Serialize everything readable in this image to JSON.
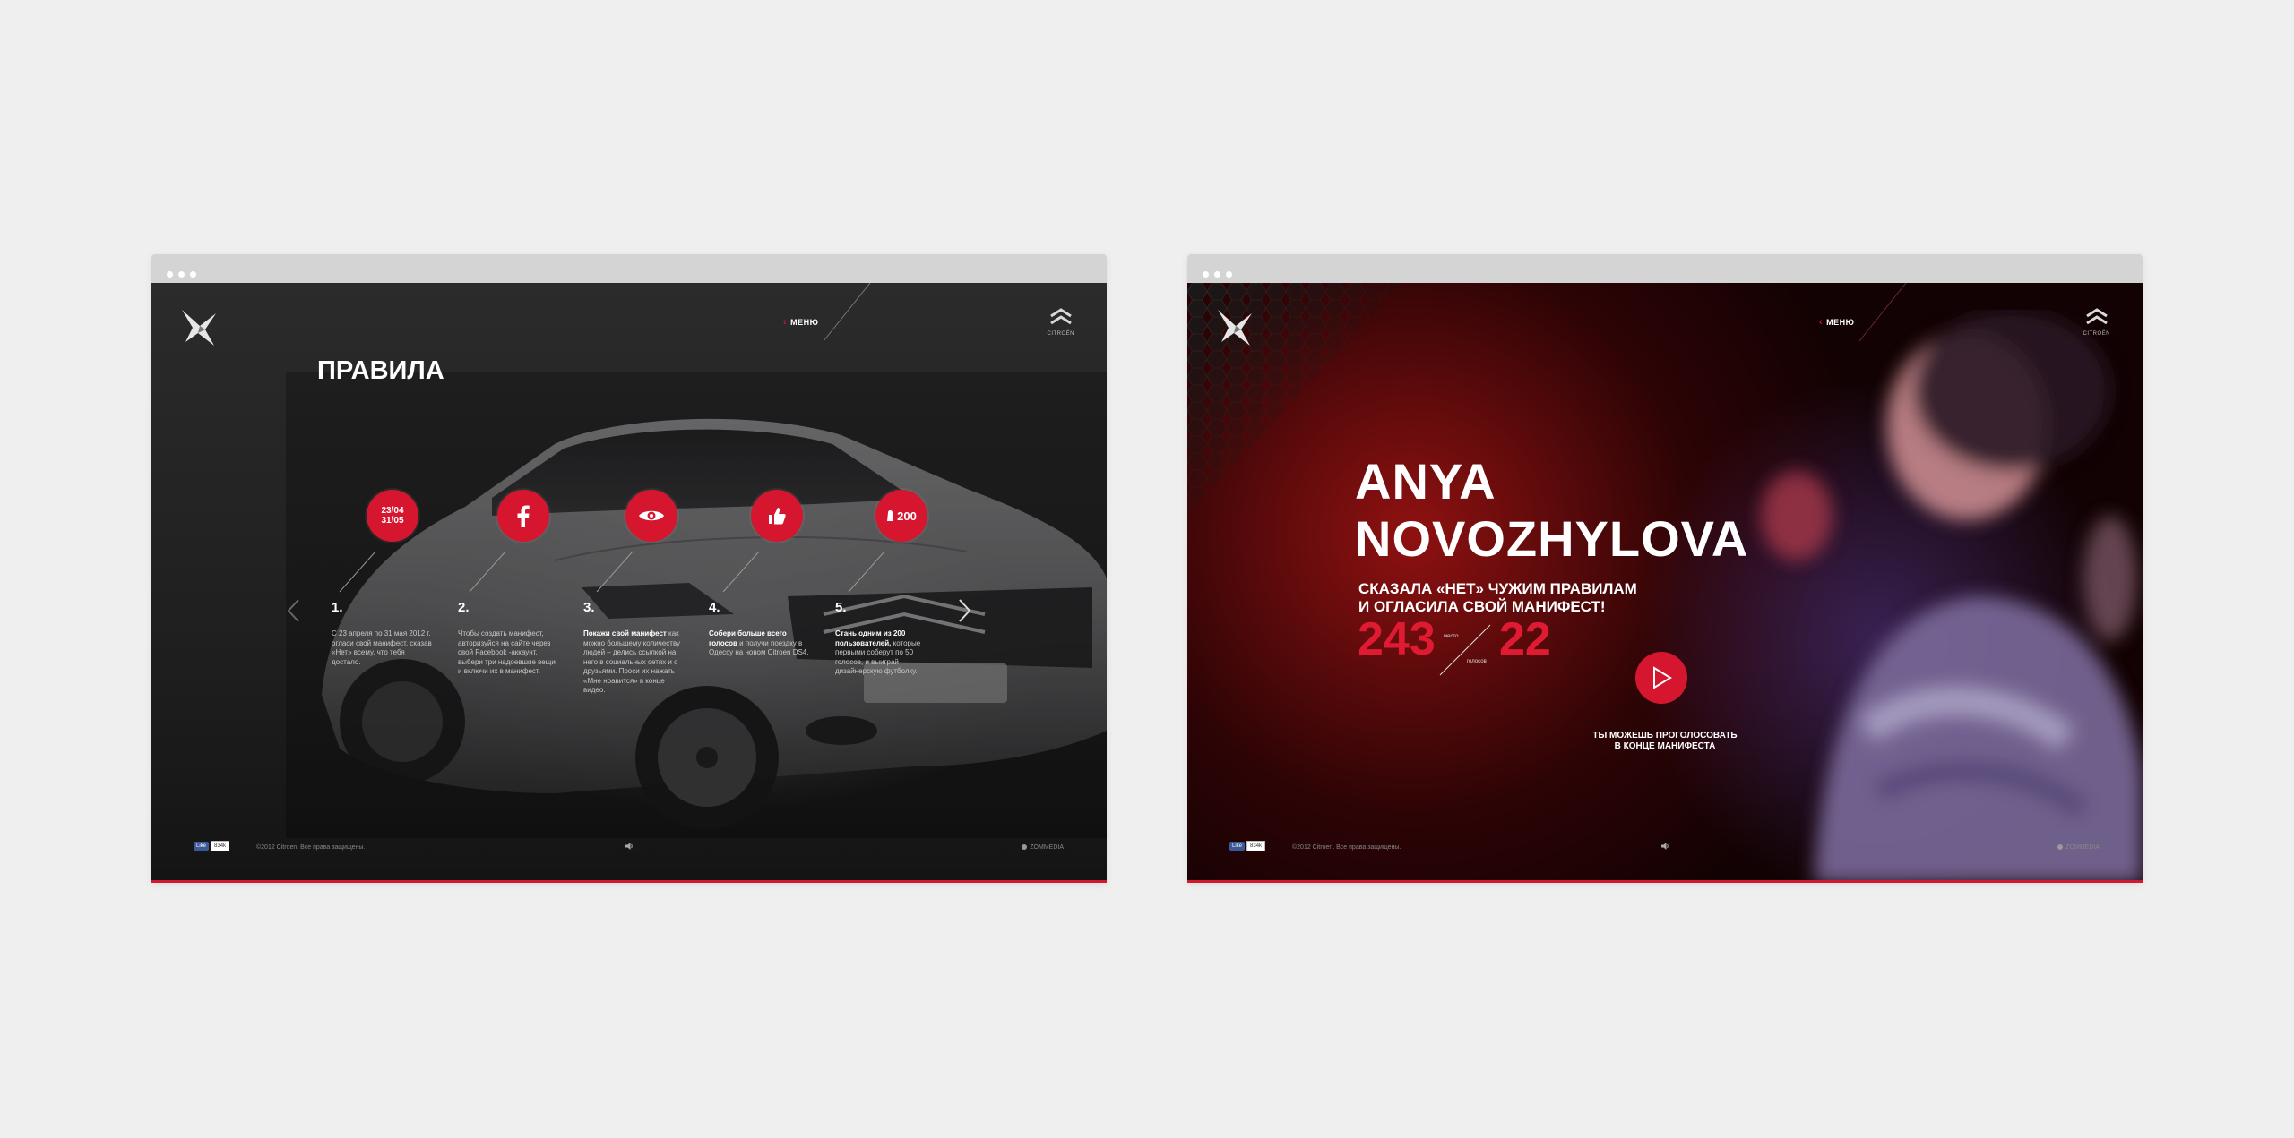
{
  "left_window": {
    "menu_label": "МЕНЮ",
    "brand_word": "CITROËN",
    "title": "ПРАВИЛА",
    "steps": [
      {
        "badge": "23/04\n31/05",
        "num": "1.",
        "bold": "",
        "text": "С 23 апреля по 31 мая 2012 г. огласи свой манифест, сказав «Нет» всему, что тебя достало."
      },
      {
        "badge": "",
        "num": "2.",
        "bold": "",
        "text": "Чтобы создать манифест, авторизуйся на сайте через свой Facebook -аккаунт, выбери три надоевшие вещи и включи их в манифест."
      },
      {
        "badge": "",
        "num": "3.",
        "bold": "Покажи свой манифест",
        "text": "как можно большему количеству людей – делись ссылкой на него в социальных сетях и с друзьями. Проси их нажать «Мне нравится» в конце видео."
      },
      {
        "badge": "",
        "num": "4.",
        "bold": "Собери больше всего голосов",
        "text": "и получи поездку в Одессу на новом Citroen DS4."
      },
      {
        "badge": "200",
        "num": "5.",
        "bold": "Стань одним из 200 пользователей,",
        "text": "которые первыми соберут по 50 голосов, и выиграй дизайнерскую футболку."
      }
    ],
    "fb_like": "Like",
    "like_count": "834k",
    "copyright": "©2012 Citroen. Все права защищены.",
    "agency": "ZOMMEDIA"
  },
  "right_window": {
    "menu_label": "МЕНЮ",
    "brand_word": "CITROËN",
    "hero_name_line1": "ANYA",
    "hero_name_line2": "NOVOZHYLOVA",
    "hero_sub_line1": "СКАЗАЛА «НЕТ» ЧУЖИМ ПРАВИЛАМ",
    "hero_sub_line2": "И ОГЛАСИЛА СВОЙ МАНИФЕСТ!",
    "place_value": "243",
    "place_label": "место",
    "votes_value": "22",
    "votes_label": "голосов",
    "vote_note_line1": "ТЫ МОЖЕШЬ ПРОГОЛОСОВАТЬ",
    "vote_note_line2": "В КОНЦЕ МАНИФЕСТА",
    "fb_like": "Like",
    "like_count": "834k",
    "copyright": "©2012 Citroen. Все права защищены.",
    "agency": "ZOMMEDIA"
  },
  "colors": {
    "accent_red": "#d6162e",
    "background": "#efefef",
    "titlebar": "#d4d4d4"
  }
}
